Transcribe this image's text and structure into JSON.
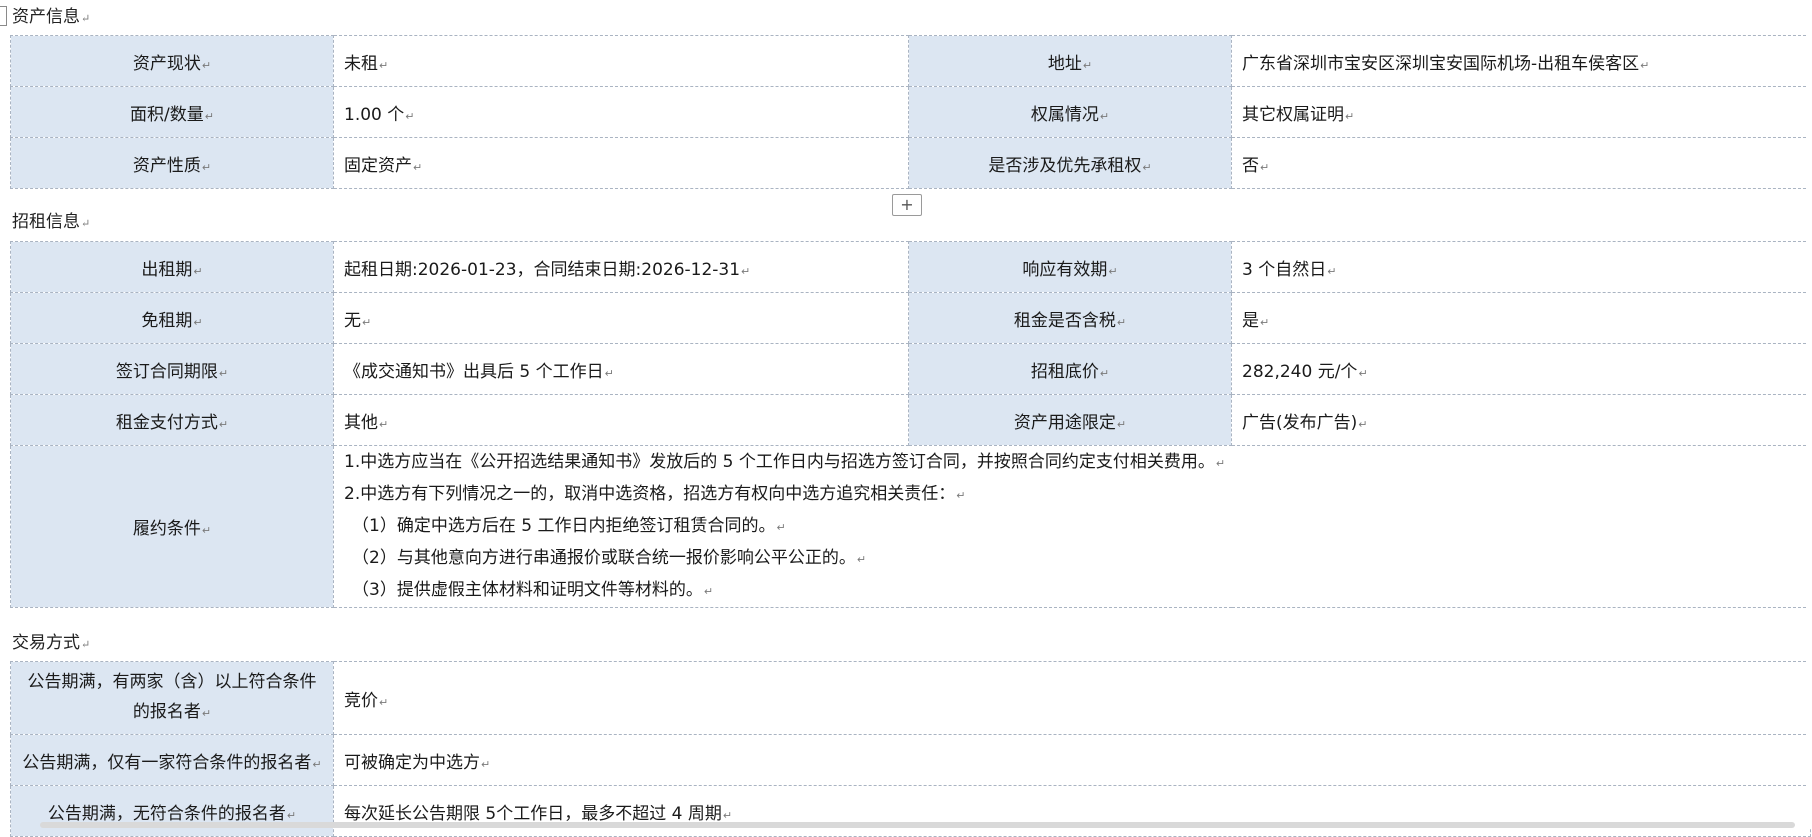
{
  "sections": {
    "asset_title": "资产信息",
    "lease_title": "招租信息",
    "trade_title": "交易方式"
  },
  "para_mark": "↵",
  "add_button": "+",
  "asset_info": {
    "rows": [
      {
        "l1": "资产现状",
        "v1": "未租",
        "l2": "地址",
        "v2": "广东省深圳市宝安区深圳宝安国际机场-出租车侯客区"
      },
      {
        "l1": "面积/数量",
        "v1": "1.00 个",
        "l2": "权属情况",
        "v2": "其它权属证明"
      },
      {
        "l1": "资产性质",
        "v1": "固定资产",
        "l2": "是否涉及优先承租权",
        "v2": "否"
      }
    ]
  },
  "lease_info": {
    "rows": [
      {
        "l1": "出租期",
        "v1": "起租日期:2026-01-23，合同结束日期:2026-12-31",
        "l2": "响应有效期",
        "v2": "3 个自然日"
      },
      {
        "l1": "免租期",
        "v1": "无",
        "l2": "租金是否含税",
        "v2": "是"
      },
      {
        "l1": "签订合同期限",
        "v1": "《成交通知书》出具后 5 个工作日",
        "l2": "招租底价",
        "v2": "282,240 元/个"
      },
      {
        "l1": "租金支付方式",
        "v1": "其他",
        "l2": "资产用途限定",
        "v2": "广告(发布广告)"
      }
    ],
    "conditions_label": "履约条件",
    "conditions": [
      "1.中选方应当在《公开招选结果通知书》发放后的 5 个工作日内与招选方签订合同，并按照合同约定支付相关费用。",
      "2.中选方有下列情况之一的，取消中选资格，招选方有权向中选方追究相关责任：",
      "（1）确定中选方后在 5 工作日内拒绝签订租赁合同的。",
      "（2）与其他意向方进行串通报价或联合统一报价影响公平公正的。",
      "（3）提供虚假主体材料和证明文件等材料的。"
    ]
  },
  "trade_info": {
    "rows": [
      {
        "label_line1": "公告期满，有两家（含）以上符合条件",
        "label_line2": "的报名者",
        "value": "竞价"
      },
      {
        "label": "公告期满，仅有一家符合条件的报名者",
        "value": "可被确定为中选方"
      },
      {
        "label": "公告期满，无符合条件的报名者",
        "value": "每次延长公告期限 5个工作日，最多不超过 4 周期"
      }
    ]
  }
}
